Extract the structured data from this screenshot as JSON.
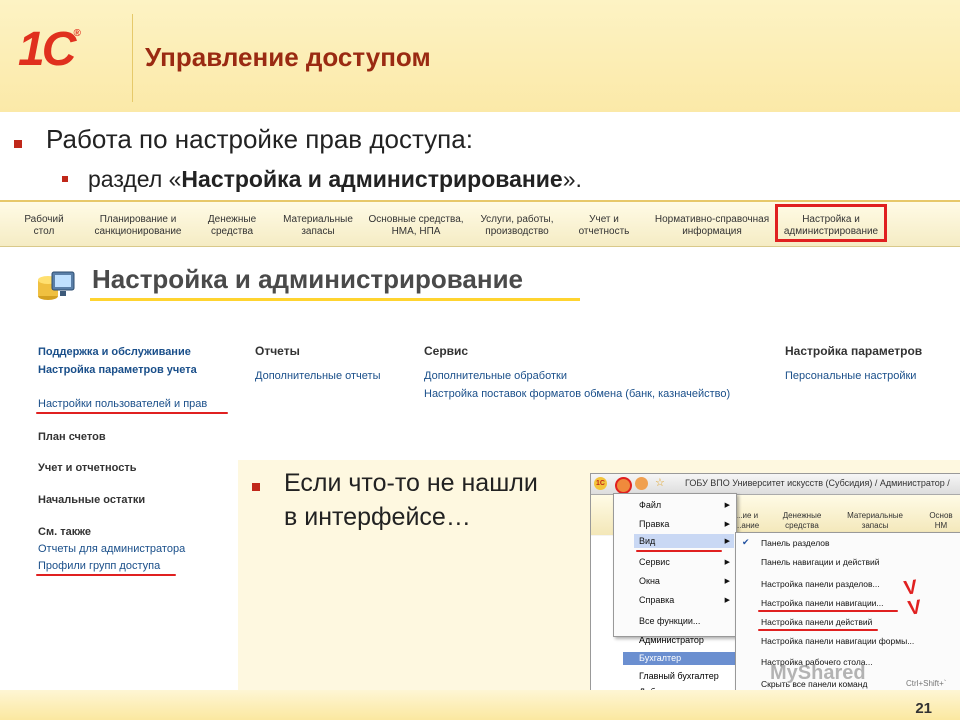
{
  "header": {
    "logo": "1С",
    "logo_mark": "®",
    "title": "Управление доступом"
  },
  "bullets": {
    "main": "Работа по настройке прав доступа:",
    "sub_prefix": "раздел «",
    "sub_bold": "Настройка и администрирование",
    "sub_suffix": "»."
  },
  "app": {
    "nav": [
      {
        "label": "Рабочий\nстол"
      },
      {
        "label": "Планирование и\nсанкционирование"
      },
      {
        "label": "Денежные\nсредства"
      },
      {
        "label": "Материальные\nзапасы"
      },
      {
        "label": "Основные средства,\nНМА, НПА"
      },
      {
        "label": "Услуги, работы,\nпроизводство"
      },
      {
        "label": "Учет и\nотчетность"
      },
      {
        "label": "Нормативно-справочная\nинформация"
      },
      {
        "label": "Настройка и\nадминистрирование"
      }
    ],
    "section_title": "Настройка и администрирование",
    "left_links": [
      "Поддержка и обслуживание",
      "Настройка параметров учета",
      "Настройки пользователей и прав",
      "План счетов",
      "Учет и отчетность",
      "Начальные остатки",
      "См. также",
      "Отчеты для администратора",
      "Профили групп доступа"
    ],
    "reports": {
      "header": "Отчеты",
      "items": [
        "Дополнительные отчеты"
      ]
    },
    "service": {
      "header": "Сервис",
      "items": [
        "Дополнительные обработки",
        "Настройка поставок форматов обмена (банк, казначейство)"
      ]
    },
    "params": {
      "header": "Настройка параметров",
      "items": [
        "Персональные настройки"
      ]
    }
  },
  "overlay": {
    "text_line1": "Если что-то не нашли",
    "text_line2": "в интерфейсе…"
  },
  "screenshot": {
    "title": "ГОБУ ВПО Университет искусств (Субсидия) / Администратор /",
    "nav": [
      "...ие и\n...ание",
      "Денежные\nсредства",
      "Материальные\nзапасы",
      "Основ\nНМ"
    ],
    "menu": [
      "Файл",
      "Правка",
      "Вид",
      "Сервис",
      "Окна",
      "Справка",
      "Все функции..."
    ],
    "submenu": [
      "Панель разделов",
      "Панель навигации и действий",
      "Настройка панели разделов...",
      "Настройка панели навигации...",
      "Настройка панели действий",
      "Настройка панели навигации формы...",
      "Настройка рабочего стола...",
      "Скрыть все панели команд"
    ],
    "shortcut": "Ctrl+Shift+`",
    "users": [
      "Администратор",
      "Бухгалтер",
      "Главный бухгалтер",
      "Добавление организа"
    ]
  },
  "watermark": "MyShared",
  "page_number": "21",
  "colors": {
    "accent_red": "#e02020",
    "title_color": "#9a2a12",
    "header_bg": "#fbe9a8",
    "link_blue": "#1a4f8a"
  }
}
